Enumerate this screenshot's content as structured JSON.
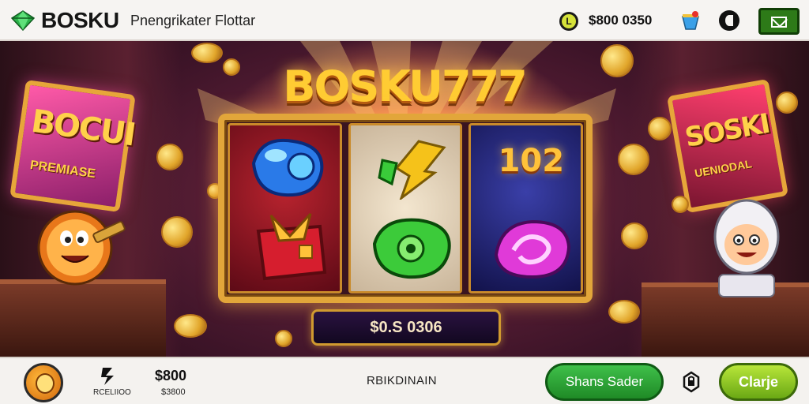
{
  "header": {
    "brand": "BOSKU",
    "subtitle": "Pnengrikater Flottar",
    "coin_badge": "L",
    "balance": "$800 0350"
  },
  "scene": {
    "title_logo": "BOSKU777",
    "sign_left": {
      "title": "BOCUI",
      "subtitle": "PREMIASE"
    },
    "sign_right": {
      "title": "SOSKI",
      "subtitle": "UENIODAL"
    },
    "reel3_number": "102",
    "win_display": "$0.S 0306"
  },
  "footer": {
    "slot_label": "RCELIIOO",
    "balance_main": "$800",
    "balance_sub": "$3800",
    "mid_label": "RBIKDINAIN",
    "spin_button": "Shans Sader",
    "action_button": "Clarje"
  },
  "colors": {
    "gold": "#e2a63a",
    "green_button": "#2d9a33",
    "lime_button": "#8ccc24",
    "topbar_bg": "#f6f4f2"
  },
  "icons": [
    "diamond-logo-icon",
    "coin-status-icon",
    "notification-icon",
    "timer-icon",
    "mail-icon",
    "slot-icon",
    "lock-icon"
  ]
}
